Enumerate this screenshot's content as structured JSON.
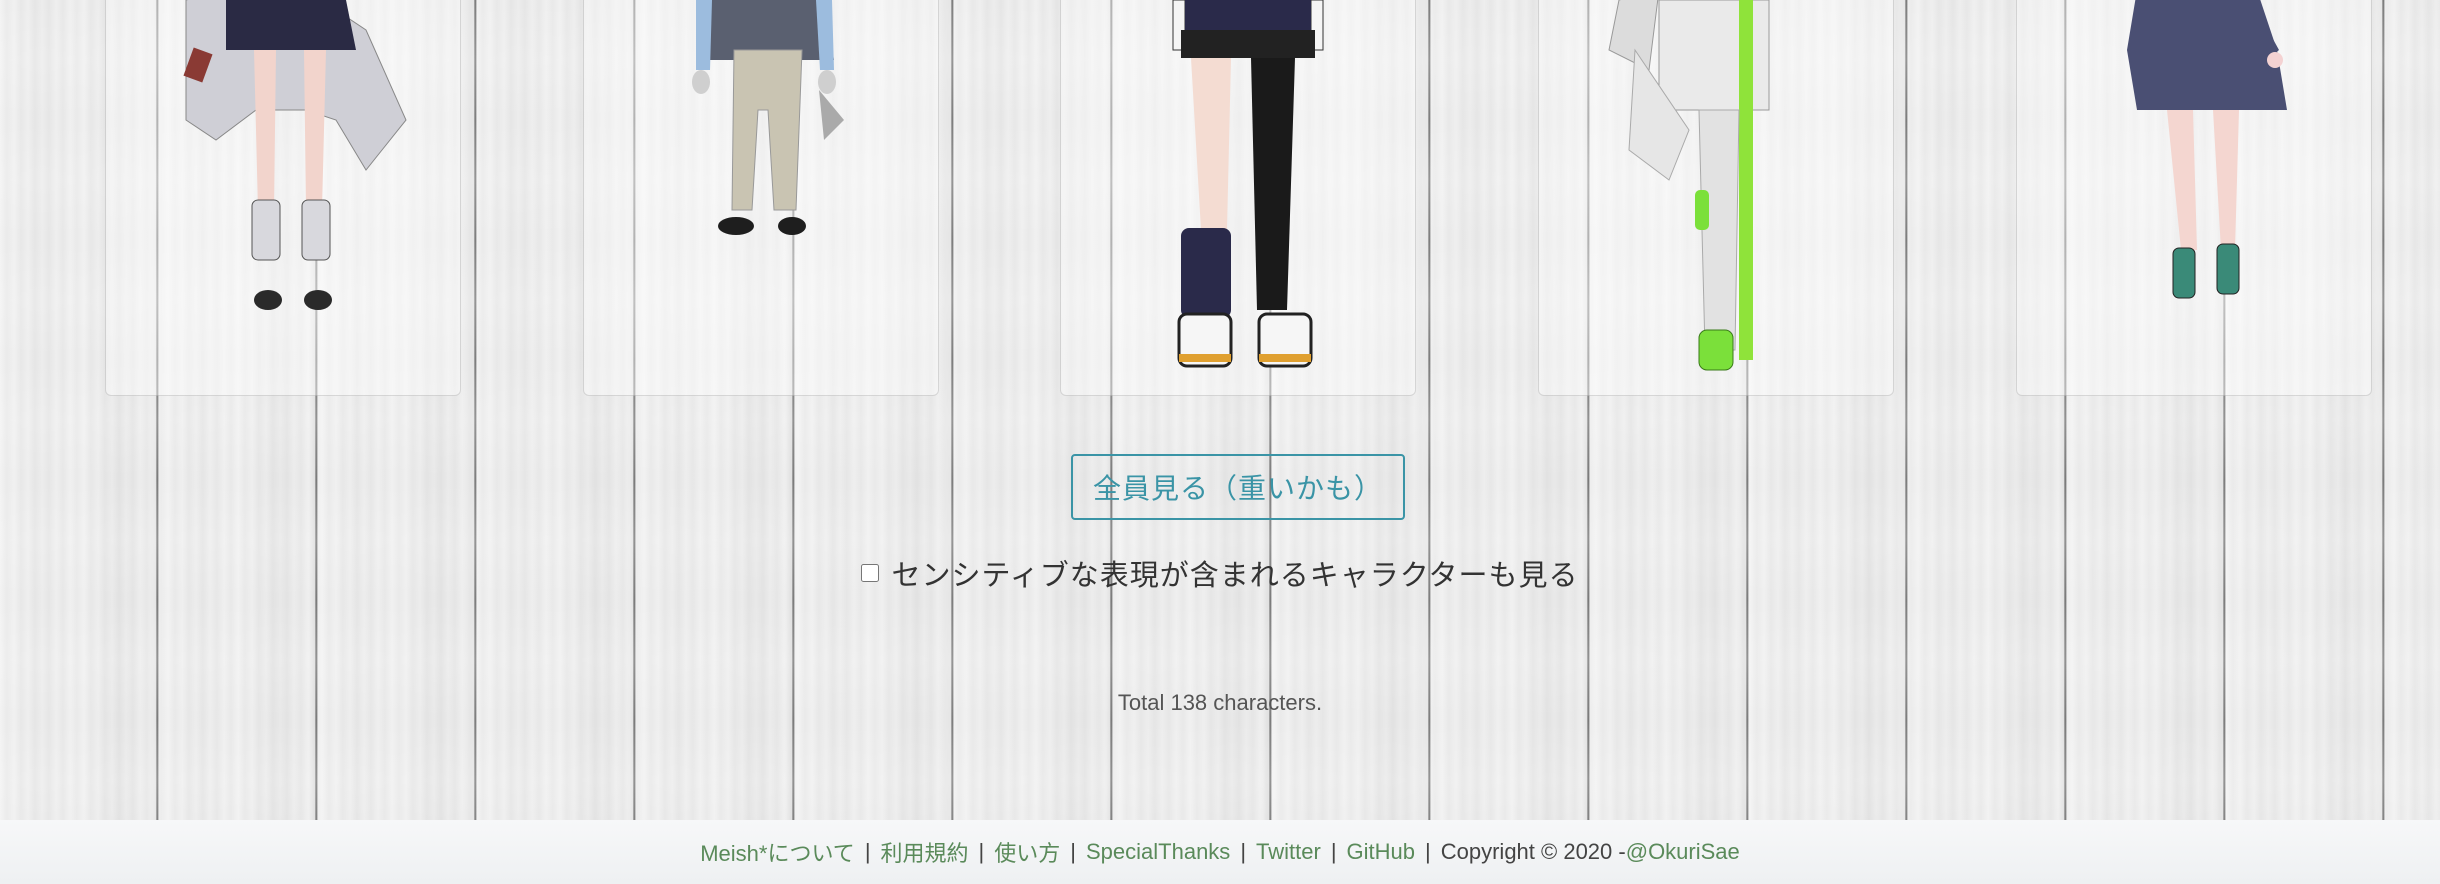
{
  "buttons": {
    "show_all": "全員見る（重いかも）"
  },
  "sensitive_toggle": {
    "label": "センシティブな表現が含まれるキャラクターも見る",
    "checked": false
  },
  "summary": {
    "total_text": "Total 138 characters."
  },
  "footer": {
    "links": [
      "Meish*について",
      "利用規約",
      "使い方",
      "SpecialThanks",
      "Twitter",
      "GitHub"
    ],
    "separator": "|",
    "copyright_prefix": "Copyright © 2020 - ",
    "author_link": "@OkuriSae"
  },
  "colors": {
    "accent": "#3a94a6",
    "footer_link": "#5a8a5a",
    "text": "#333333"
  }
}
